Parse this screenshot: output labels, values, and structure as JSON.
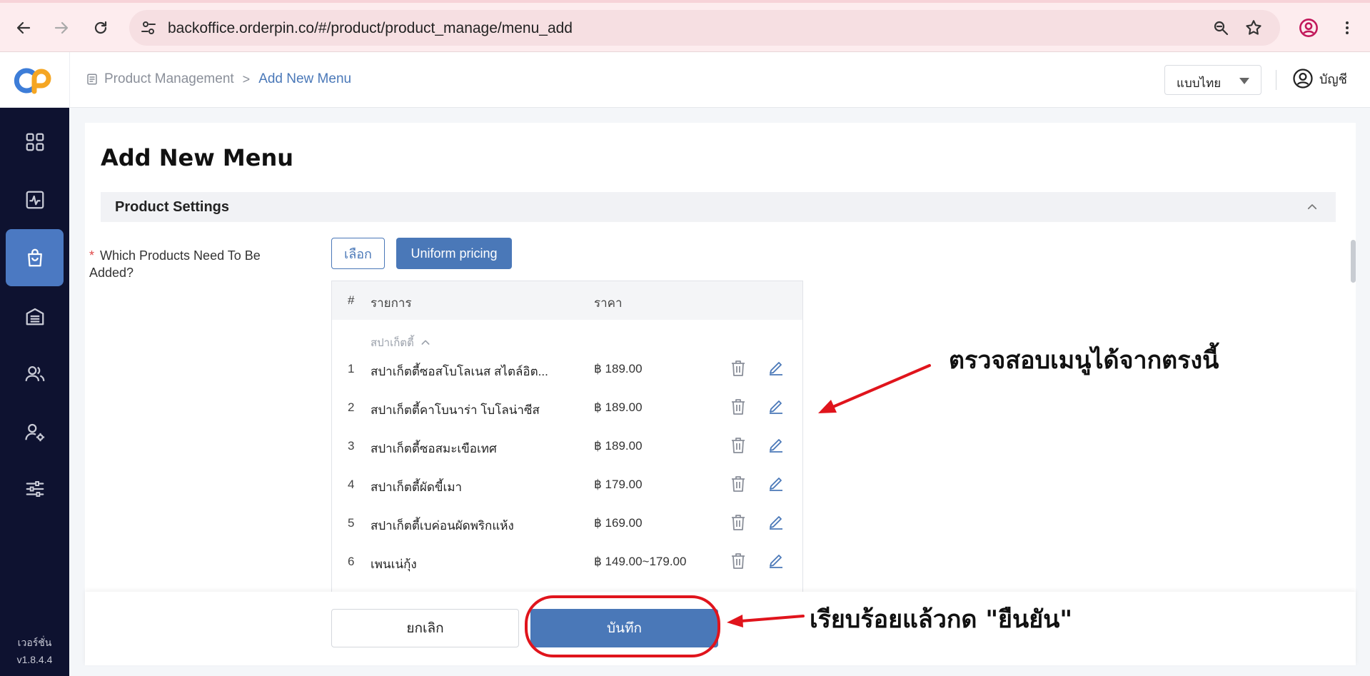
{
  "browser": {
    "url": "backoffice.orderpin.co/#/product/product_manage/menu_add"
  },
  "header": {
    "breadcrumb_root": "Product Management",
    "breadcrumb_separator": ">",
    "breadcrumb_current": "Add New Menu",
    "language": "แบบไทย",
    "account_label": "บัญชี"
  },
  "sidebar": {
    "items": [
      {
        "icon": "dashboard-grid-icon"
      },
      {
        "icon": "analytics-chart-icon"
      },
      {
        "icon": "shopping-bag-icon",
        "active": true
      },
      {
        "icon": "inventory-icon"
      },
      {
        "icon": "users-group-icon"
      },
      {
        "icon": "user-settings-icon"
      },
      {
        "icon": "sliders-icon"
      }
    ],
    "version_label": "เวอร์ชั่น",
    "version_number": "v1.8.4.4"
  },
  "page": {
    "title": "Add New Menu",
    "section_title": "Product Settings",
    "field_required_mark": "*",
    "field_label": "Which Products Need To Be Added?",
    "select_button": "เลือก",
    "uniform_button": "Uniform pricing"
  },
  "table": {
    "headers": {
      "num": "#",
      "item": "รายการ",
      "price": "ราคา"
    },
    "group_name": "สปาเก็ตตี้",
    "rows": [
      {
        "num": "1",
        "name": "สปาเก็ตตี้ซอสโบโลเนส สไตล์อิต...",
        "price": "฿ 189.00"
      },
      {
        "num": "2",
        "name": "สปาเก็ตตี้คาโบนาร่า โบโลน่าซีส",
        "price": "฿ 189.00"
      },
      {
        "num": "3",
        "name": "สปาเก็ตตี้ซอสมะเขือเทศ",
        "price": "฿ 189.00"
      },
      {
        "num": "4",
        "name": "สปาเก็ตตี้ผัดขี้เมา",
        "price": "฿ 179.00"
      },
      {
        "num": "5",
        "name": "สปาเก็ตตี้เบค่อนผัดพริกแห้ง",
        "price": "฿ 169.00"
      },
      {
        "num": "6",
        "name": "เพนเน่กุ้ง",
        "price": "฿ 149.00~179.00"
      }
    ]
  },
  "footer": {
    "cancel_button": "ยกเลิก",
    "save_button": "บันทึก"
  },
  "annotations": {
    "note_check": "ตรวจสอบเมนูได้จากตรงนี้",
    "note_confirm": "เรียบร้อยแล้วกด \"ยืนยัน\"",
    "color": "#e0141c"
  }
}
